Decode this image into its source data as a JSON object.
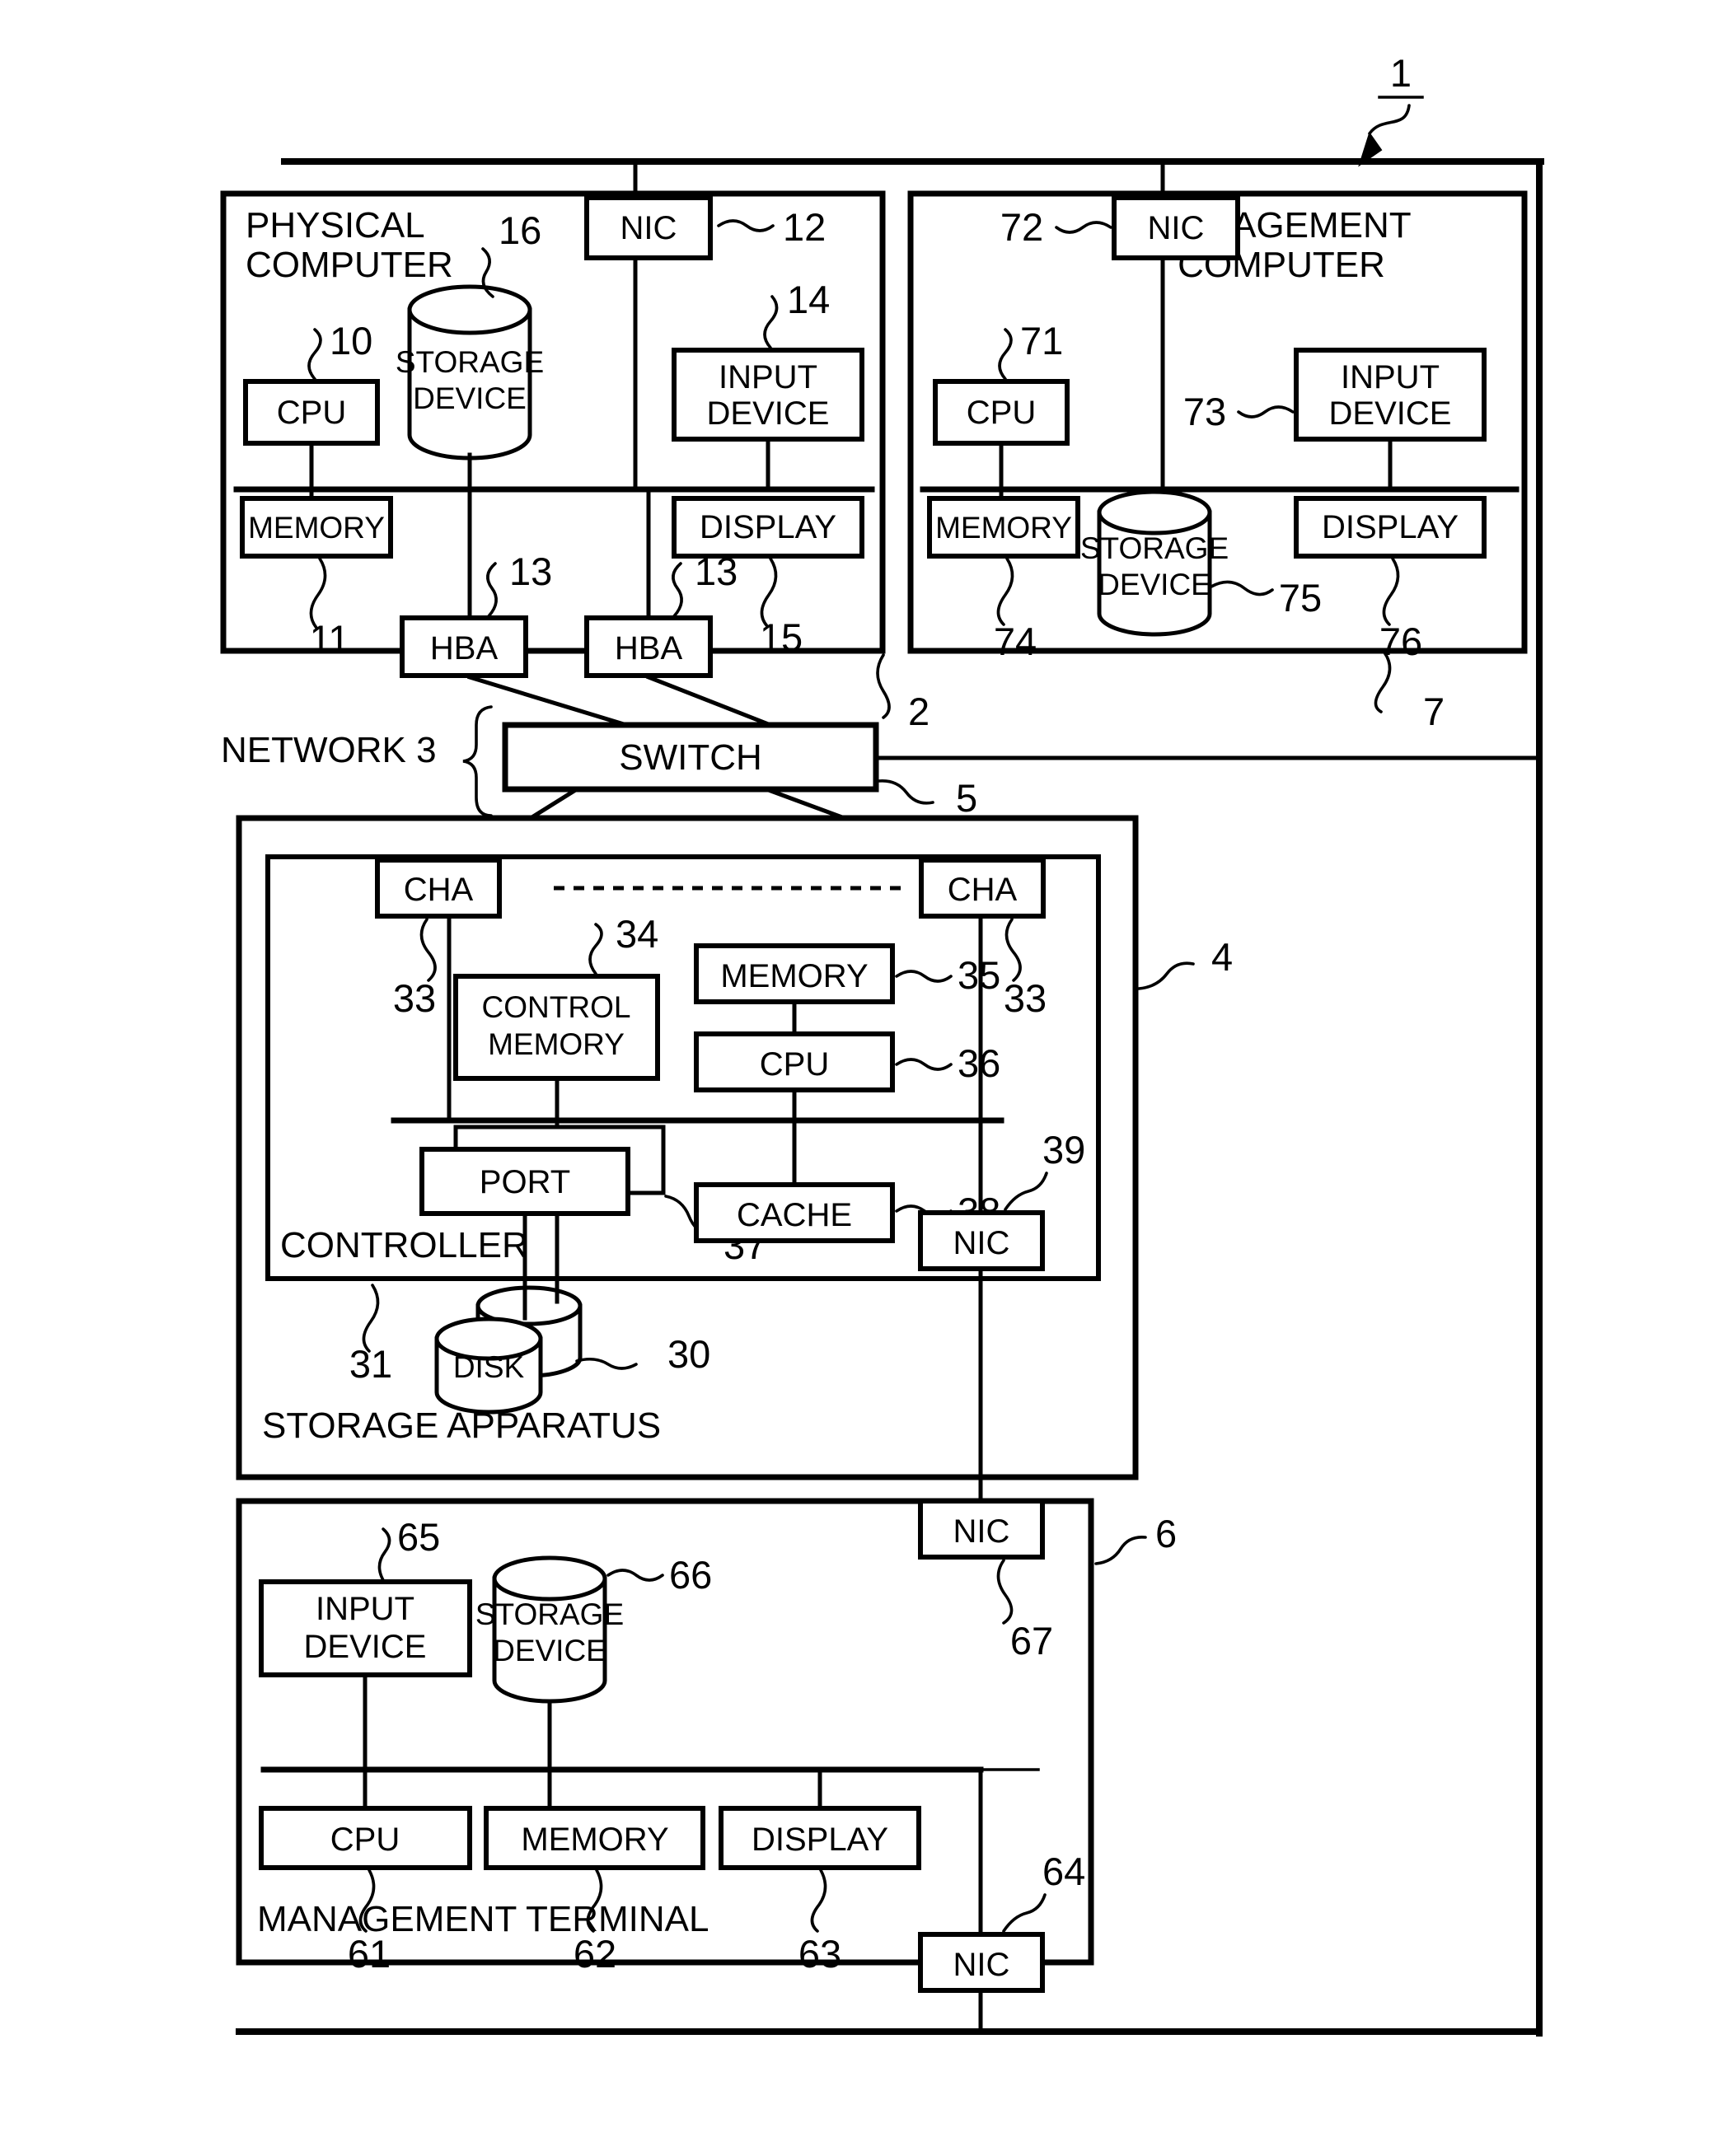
{
  "figure": {
    "figure_number": "1",
    "system_label": "1"
  },
  "outer_frame": {
    "name": "system-boundary"
  },
  "physical_computer": {
    "title_line1": "PHYSICAL",
    "title_line2": "COMPUTER",
    "ref": "2",
    "components": {
      "cpu": {
        "label": "CPU",
        "ref": "10"
      },
      "memory": {
        "label": "MEMORY",
        "ref": "11"
      },
      "nic": {
        "label": "NIC",
        "ref": "12"
      },
      "hba_left": {
        "label": "HBA",
        "ref": "13"
      },
      "hba_right": {
        "label": "HBA",
        "ref": "13"
      },
      "hba_ellipsis": "---",
      "input_device": {
        "label_line1": "INPUT",
        "label_line2": "DEVICE",
        "ref": "14"
      },
      "display": {
        "label": "DISPLAY",
        "ref": "15"
      },
      "storage_device": {
        "label_line1": "STORAGE",
        "label_line2": "DEVICE",
        "ref": "16"
      }
    }
  },
  "management_computer": {
    "title_line1": "MANAGEMENT",
    "title_line2": "COMPUTER",
    "ref": "7",
    "components": {
      "cpu": {
        "label": "CPU",
        "ref": "71"
      },
      "nic": {
        "label": "NIC",
        "ref": "72"
      },
      "input_device": {
        "label_line1": "INPUT",
        "label_line2": "DEVICE",
        "ref": "73"
      },
      "memory": {
        "label": "MEMORY",
        "ref": "74"
      },
      "storage_device": {
        "label_line1": "STORAGE",
        "label_line2": "DEVICE",
        "ref": "75"
      },
      "display": {
        "label": "DISPLAY",
        "ref": "76"
      }
    }
  },
  "network": {
    "label": "NETWORK 3",
    "switch": {
      "label": "SWITCH",
      "ref": "5"
    }
  },
  "storage_apparatus": {
    "title": "STORAGE APPARATUS",
    "ref": "4",
    "controller": {
      "label": "CONTROLLER",
      "ref": "31"
    },
    "components": {
      "cha_left": {
        "label": "CHA",
        "ref": "33"
      },
      "cha_right": {
        "label": "CHA",
        "ref": "33"
      },
      "cha_ellipsis": "- - - - - - - - - - - - - - - - -",
      "control_memory": {
        "label_line1": "CONTROL",
        "label_line2": "MEMORY",
        "ref": "34"
      },
      "memory": {
        "label": "MEMORY",
        "ref": "35"
      },
      "cpu": {
        "label": "CPU",
        "ref": "36"
      },
      "port": {
        "label": "PORT",
        "ref": "37"
      },
      "cache": {
        "label": "CACHE",
        "ref": "38"
      },
      "nic": {
        "label": "NIC",
        "ref": "39"
      },
      "disk": {
        "label": "DISK",
        "ref": "30"
      }
    }
  },
  "management_terminal": {
    "title": "MANAGEMENT TERMINAL",
    "ref": "6",
    "components": {
      "cpu": {
        "label": "CPU",
        "ref": "61"
      },
      "memory": {
        "label": "MEMORY",
        "ref": "62"
      },
      "display": {
        "label": "DISPLAY",
        "ref": "63"
      },
      "nic_bottom": {
        "label": "NIC",
        "ref": "64"
      },
      "input_device": {
        "label_line1": "INPUT",
        "label_line2": "DEVICE",
        "ref": "65"
      },
      "storage_device": {
        "label_line1": "STORAGE",
        "label_line2": "DEVICE",
        "ref": "66"
      },
      "nic_top": {
        "label": "NIC",
        "ref": "67"
      }
    }
  },
  "colors": {
    "ink": "#000000",
    "paper": "#ffffff"
  }
}
